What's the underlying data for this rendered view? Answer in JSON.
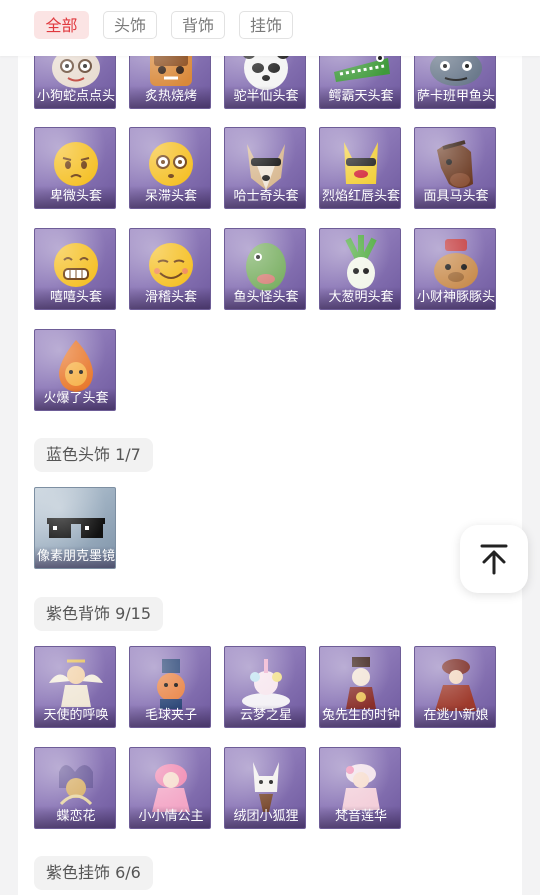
{
  "tabs": [
    {
      "label": "全部",
      "active": true
    },
    {
      "label": "头饰",
      "active": false
    },
    {
      "label": "背饰",
      "active": false
    },
    {
      "label": "挂饰",
      "active": false
    }
  ],
  "sections": {
    "purple_head_rows": [
      [
        "小狗蛇点点头",
        "炙热烧烤",
        "驼半仙头套",
        "鳄霸天头套",
        "萨卡班甲鱼头"
      ],
      [
        "卑微头套",
        "呆滞头套",
        "哈士奇头套",
        "烈焰红唇头套",
        "面具马头套"
      ],
      [
        "嘻嘻头套",
        "滑稽头套",
        "鱼头怪头套",
        "大葱明头套",
        "小财神豚豚头"
      ],
      [
        "火爆了头套"
      ]
    ],
    "blue_head": {
      "title": "蓝色头饰 1/7",
      "items": [
        "像素朋克墨镜"
      ]
    },
    "purple_back": {
      "title": "紫色背饰 9/15",
      "rows": [
        [
          "天使的呼唤",
          "毛球夹子",
          "云梦之星",
          "兔先生的时钟",
          "在逃小新娘"
        ],
        [
          "蝶恋花",
          "小小情公主",
          "绒团小狐狸",
          "梵音莲华"
        ]
      ]
    },
    "purple_hanging": {
      "title": "紫色挂饰 6/6"
    }
  },
  "icons": {
    "back_to_top": "arrow-up-to-line-icon"
  },
  "colors": {
    "accent": "#e0393e",
    "accent_bg": "#fbe4e4",
    "card_purple": "#8d79b8",
    "card_blue": "#9fb1c2"
  }
}
